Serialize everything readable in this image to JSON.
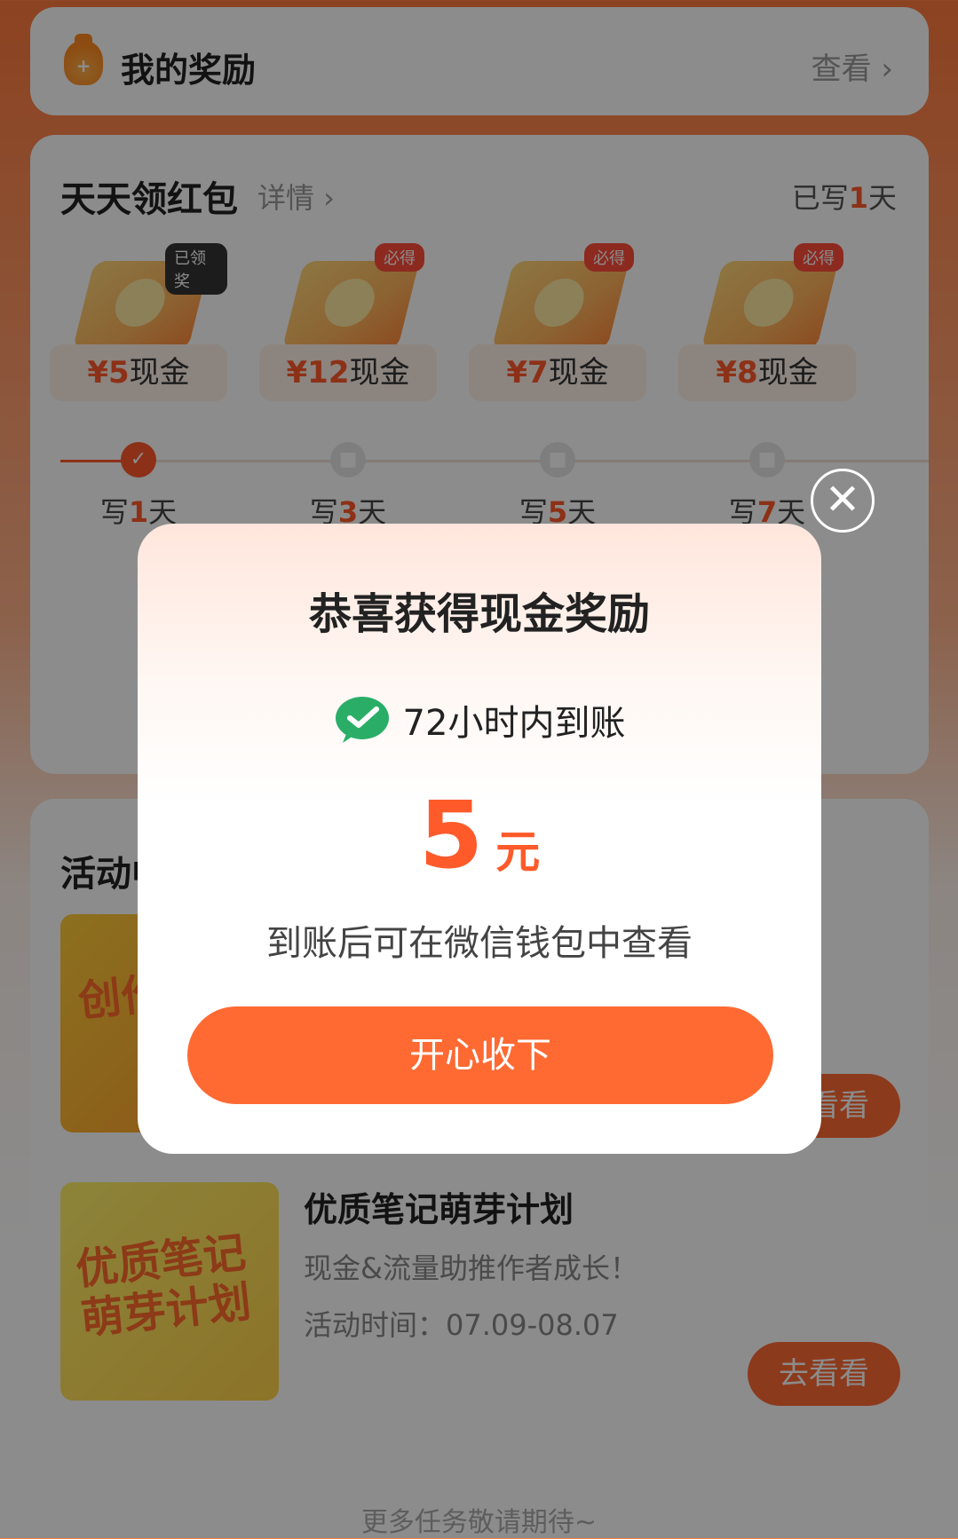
{
  "reward_bar": {
    "title": "我的奖励",
    "link": "查看 ›"
  },
  "daily": {
    "title": "天天领红包",
    "detail": "详情 ›",
    "status_prefix": "已写",
    "status_count": "1",
    "status_suffix": "天",
    "days": [
      {
        "badge": "已领奖",
        "amount": "¥5",
        "unit": "现金",
        "label_prefix": "写",
        "label_count": "1",
        "label_suffix": "天",
        "done": true
      },
      {
        "badge": "必得",
        "amount": "¥12",
        "unit": "现金",
        "label_prefix": "写",
        "label_count": "3",
        "label_suffix": "天",
        "done": false
      },
      {
        "badge": "必得",
        "amount": "¥7",
        "unit": "现金",
        "label_prefix": "写",
        "label_count": "5",
        "label_suffix": "天",
        "done": false
      },
      {
        "badge": "必得",
        "amount": "¥8",
        "unit": "现金",
        "label_prefix": "写",
        "label_count": "7",
        "label_suffix": "天",
        "done": false
      }
    ]
  },
  "activity": {
    "title": "活动中心",
    "items": [
      {
        "thumb_text": "创作赏金",
        "button": "去看看"
      },
      {
        "thumb_text": "优质笔记萌芽计划",
        "name": "优质笔记萌芽计划",
        "desc": "现金&流量助推作者成长！",
        "time": "活动时间：07.09-08.07",
        "button": "去看看"
      }
    ]
  },
  "footer": "更多任务敬请期待~",
  "modal": {
    "title": "恭喜获得现金奖励",
    "pay_text": "72小时内到账",
    "amount": "5",
    "unit": "元",
    "hint": "到账后可在微信钱包中查看",
    "button": "开心收下",
    "close": "✕"
  },
  "colors": {
    "accent": "#ff5a2a",
    "button": "#ff6a33",
    "wechat": "#2aae67"
  },
  "icons": {
    "bag": "money-bag-icon",
    "wechat": "wechat-pay-icon",
    "close": "close-icon",
    "check": "check-icon",
    "lock": "lock-icon"
  }
}
